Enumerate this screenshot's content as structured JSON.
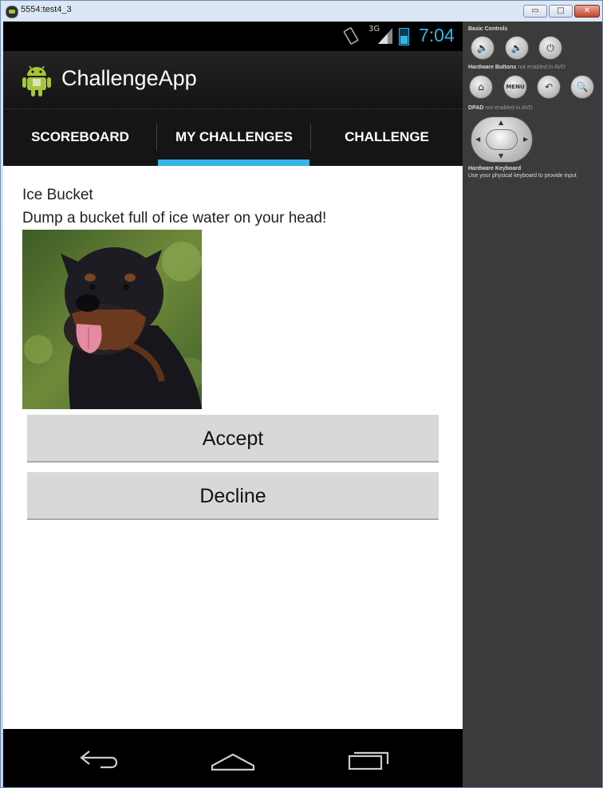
{
  "window": {
    "title": "5554:test4_3",
    "min_label": "▭",
    "max_label": "□",
    "close_label": "✕"
  },
  "statusbar": {
    "network_type": "3G",
    "clock": "7:04"
  },
  "actionbar": {
    "app_title": "ChallengeApp"
  },
  "tabs": [
    {
      "label": "SCOREBOARD",
      "selected": false
    },
    {
      "label": "MY CHALLENGES",
      "selected": true
    },
    {
      "label": "CHALLENGE",
      "selected": false
    }
  ],
  "challenge": {
    "title": "Ice Bucket",
    "description": "Dump a bucket full of ice water on your head!",
    "image_subject": "rottweiler-dog"
  },
  "buttons": {
    "accept_label": "Accept",
    "decline_label": "Decline"
  },
  "panel": {
    "basic_controls_label": "Basic Controls",
    "hardware_buttons_label": "Hardware Buttons",
    "hardware_buttons_note": "not enabled in AVD",
    "menu_label": "MENU",
    "dpad_label": "DPAD",
    "dpad_note": "not enabled in AVD",
    "hardware_keyboard_label": "Hardware Keyboard",
    "hardware_keyboard_desc": "Use your physical keyboard to provide input"
  },
  "colors": {
    "accent": "#33b5e5",
    "actionbar_bg": "#1b1b1b",
    "button_bg": "#d8d8d8"
  }
}
